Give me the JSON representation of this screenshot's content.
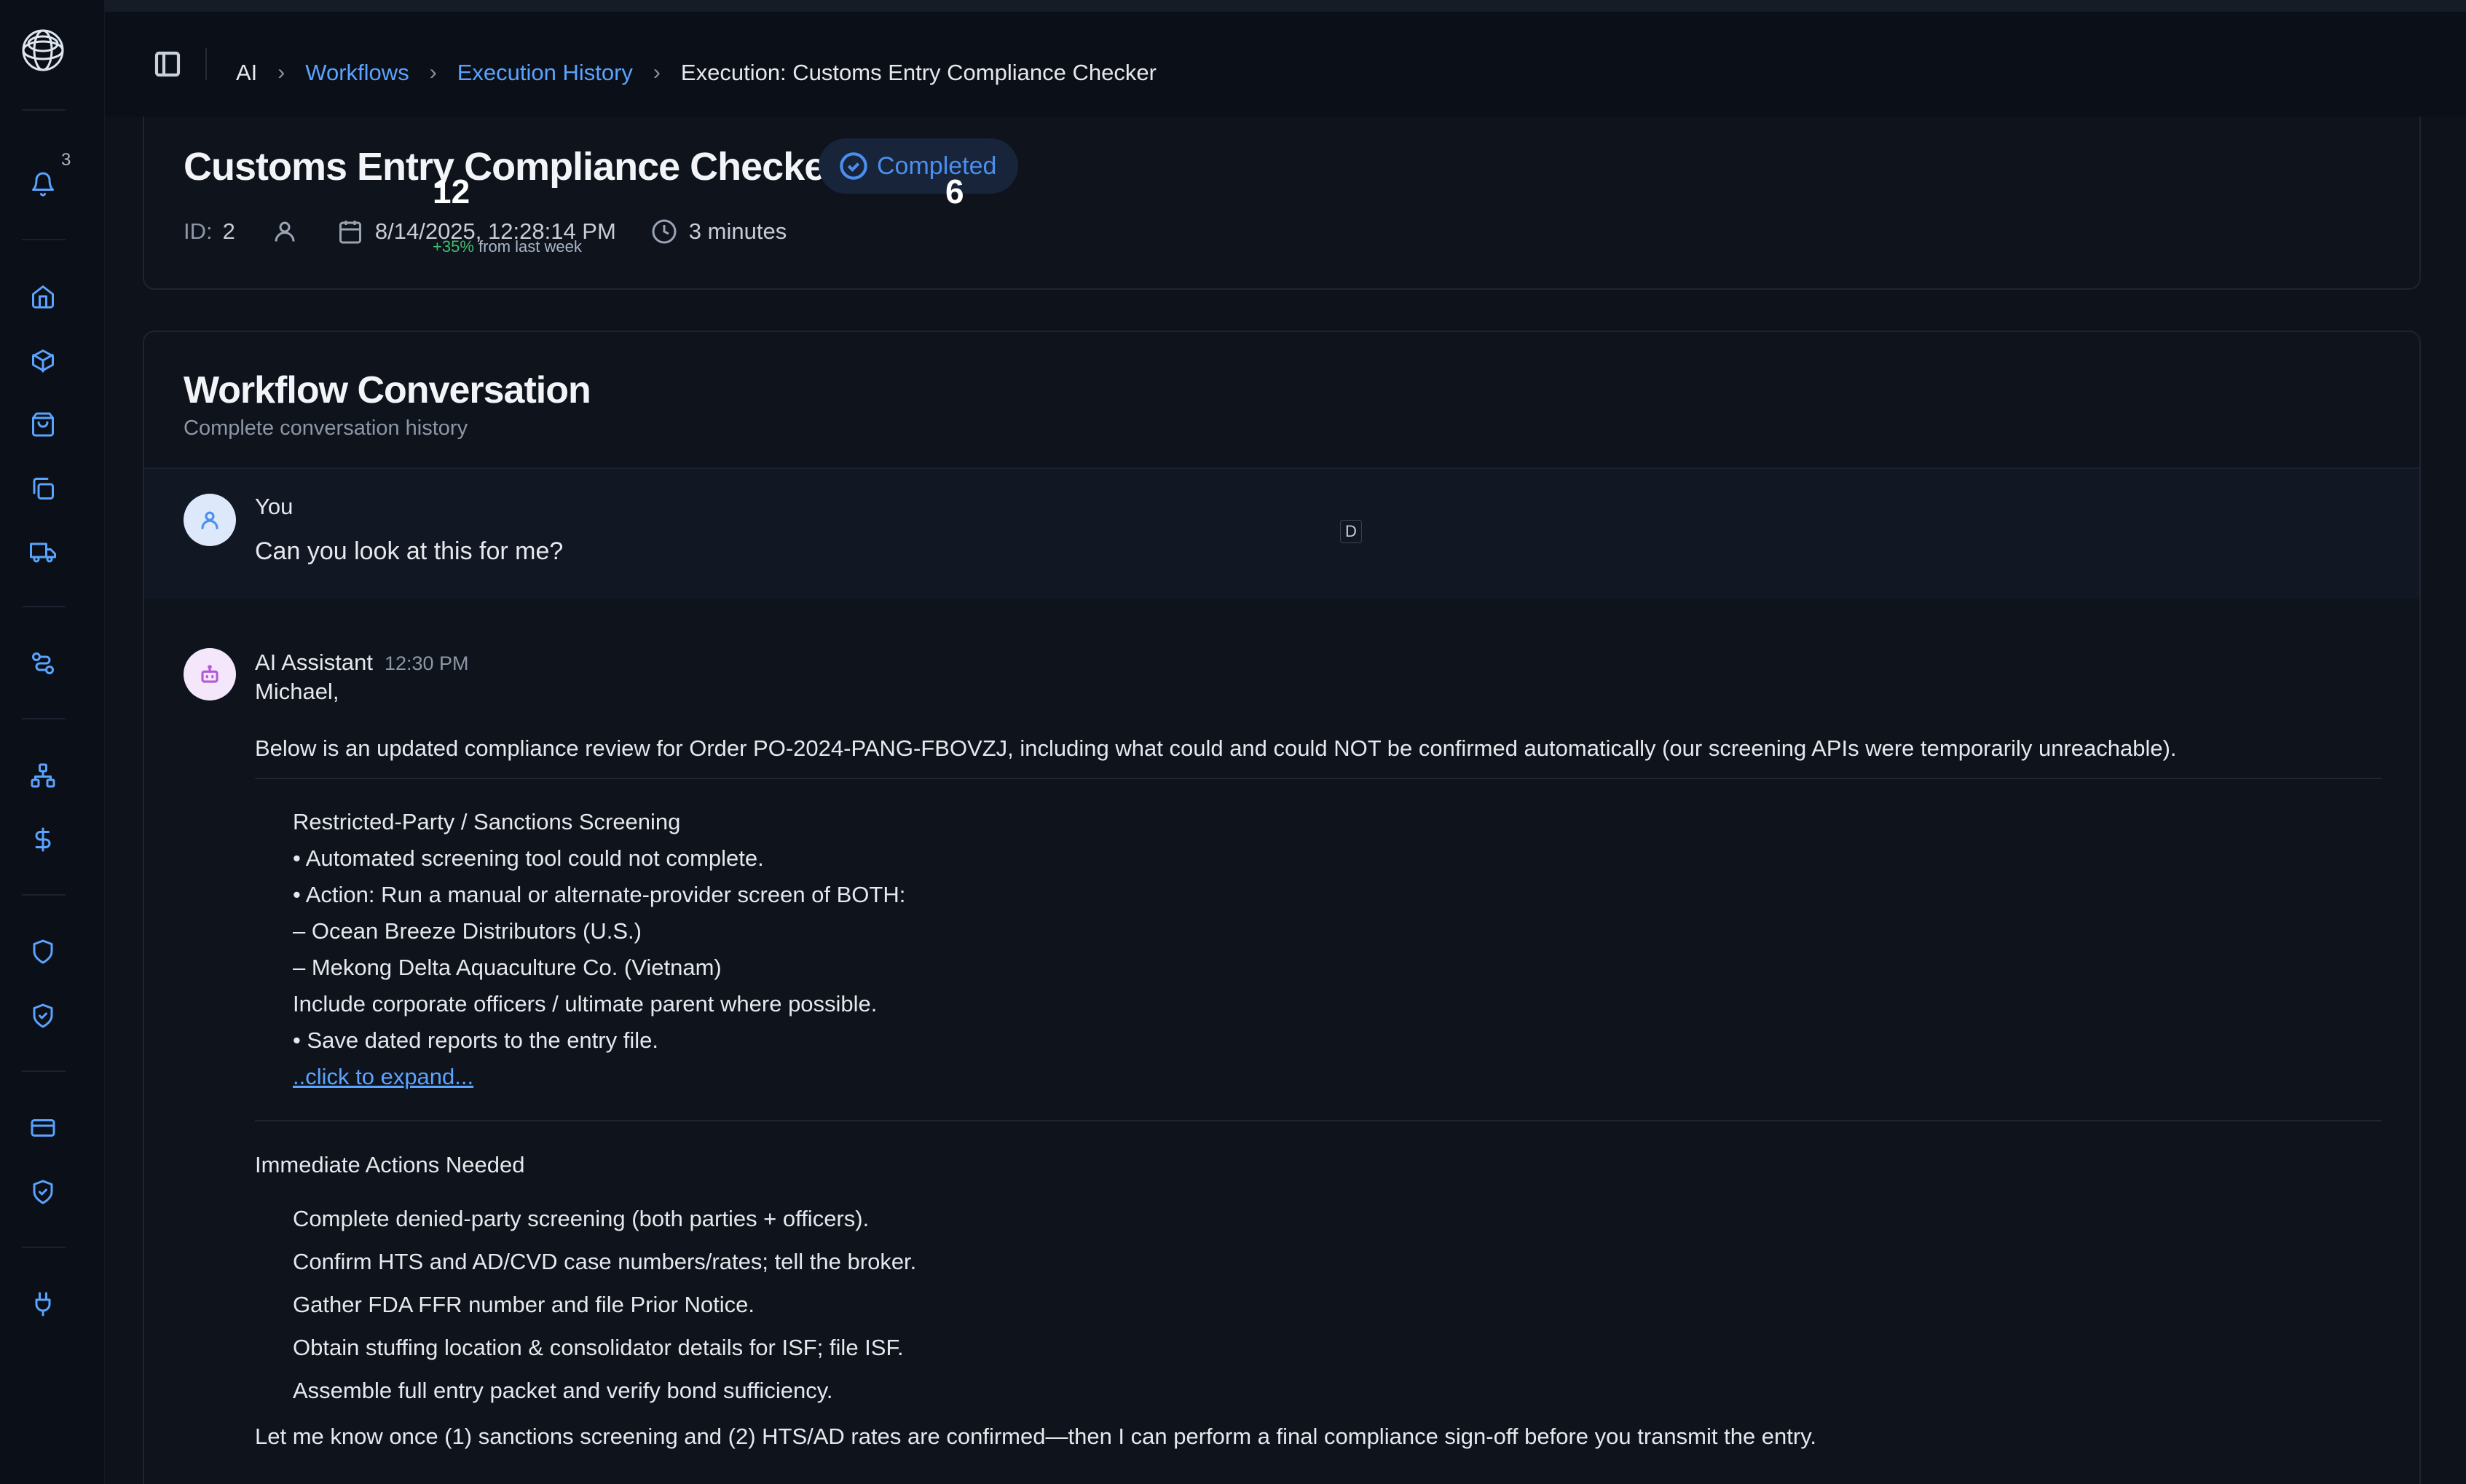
{
  "sidebar": {
    "notification_count": "3",
    "icons": [
      "bell-icon",
      "home-icon",
      "box-icon",
      "shopping-bag-icon",
      "copy-icon",
      "truck-icon",
      "route-icon",
      "network-icon",
      "dollar-icon",
      "shield-icon",
      "shield-check-icon",
      "credit-card-icon",
      "shield-check-icon",
      "plug-icon"
    ]
  },
  "breadcrumb": {
    "items": [
      "AI",
      "Workflows",
      "Execution History",
      "Execution: Customs Entry Compliance Checker"
    ]
  },
  "execution": {
    "title": "Customs Entry Compliance Checker",
    "status": "Completed",
    "id_label": "ID:",
    "id_value": "2",
    "date": "8/14/2025, 12:28:14 PM",
    "duration": "3 minutes"
  },
  "overlay": {
    "num_a": "12",
    "num_b": "6",
    "trend_pct": "+35%",
    "trend_text": "from last week",
    "cursor_key": "D"
  },
  "conversation": {
    "title": "Workflow Conversation",
    "subtitle": "Complete conversation history",
    "user_message": {
      "sender": "You",
      "text": "Can you look at this for me?"
    },
    "ai_message": {
      "sender": "AI Assistant",
      "time": "12:30 PM",
      "greeting": "Michael,",
      "intro": "Below is an updated compliance review for Order PO-2024-PANG-FBOVZJ, including what could and could NOT be confirmed automatically (our screening APIs were temporarily unreachable).",
      "section_lines": [
        "Restricted-Party / Sanctions Screening",
        "• Automated screening tool could not complete.",
        "• Action: Run a manual or alternate-provider screen of BOTH:",
        "– Ocean Breeze Distributors (U.S.)",
        "– Mekong Delta Aquaculture Co. (Vietnam)",
        "Include corporate officers / ultimate parent where possible.",
        "• Save dated reports to the entry file."
      ],
      "expand_link": "..click to expand...",
      "actions_heading": "Immediate Actions Needed",
      "actions": [
        "Complete denied-party screening (both parties + officers).",
        "Confirm HTS and AD/CVD case numbers/rates; tell the broker.",
        "Gather FDA FFR number and file Prior Notice.",
        "Obtain stuffing location & consolidator details for ISF; file ISF.",
        "Assemble full entry packet and verify bond sufficiency."
      ],
      "closing": "Let me know once (1) sanctions screening and (2) HTS/AD rates are confirmed—then I can perform a final compliance sign-off before you transmit the entry."
    }
  }
}
